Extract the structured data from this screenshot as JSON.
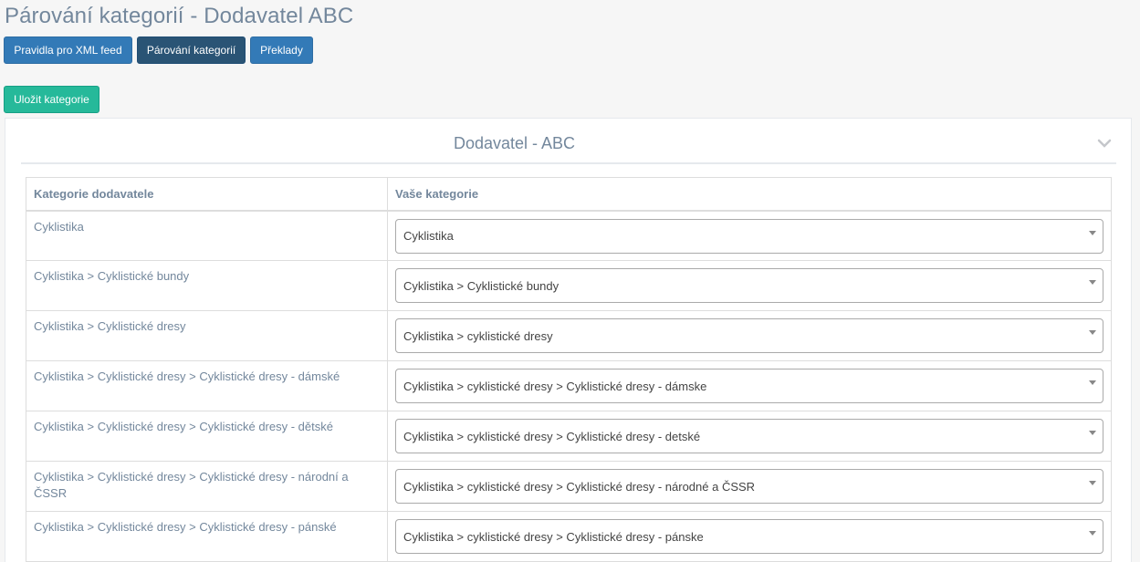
{
  "page": {
    "title": "Párování kategorií - Dodavatel ABC"
  },
  "toolbar": {
    "feed_rules_label": "Pravidla pro XML feed",
    "category_pairing_label": "Párování kategorií",
    "translations_label": "Překlady",
    "save_label": "Uložit kategorie"
  },
  "panel": {
    "title": "Dodavatel - ABC",
    "collapse_icon": "chevron-down-icon"
  },
  "table": {
    "headers": [
      "Kategorie dodavatele",
      "Vaše kategorie"
    ],
    "rows": [
      {
        "supplier": "Cyklistika",
        "mine": "Cyklistika"
      },
      {
        "supplier": "Cyklistika > Cyklistické bundy",
        "mine": "Cyklistika > Cyklistické bundy"
      },
      {
        "supplier": "Cyklistika > Cyklistické dresy",
        "mine": "Cyklistika > cyklistické dresy"
      },
      {
        "supplier": "Cyklistika > Cyklistické dresy > Cyklistické dresy - dámské",
        "mine": "Cyklistika > cyklistické dresy > Cyklistické dresy - dámske"
      },
      {
        "supplier": "Cyklistika > Cyklistické dresy > Cyklistické dresy - dětské",
        "mine": "Cyklistika > cyklistické dresy > Cyklistické dresy - detské"
      },
      {
        "supplier": "Cyklistika > Cyklistické dresy > Cyklistické dresy - národní a ČSSR",
        "mine": "Cyklistika > cyklistické dresy > Cyklistické dresy - národné a ČSSR"
      },
      {
        "supplier": "Cyklistika > Cyklistické dresy > Cyklistické dresy - pánské",
        "mine": "Cyklistika > cyklistické dresy > Cyklistické dresy - pánske"
      }
    ]
  },
  "colors": {
    "primary": "#337ab7",
    "active": "#2a5475",
    "success": "#26b99a",
    "text": "#73879c"
  }
}
